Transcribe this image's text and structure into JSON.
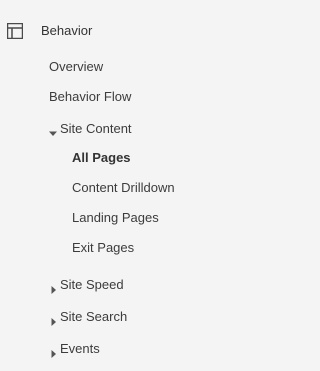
{
  "section": {
    "icon": "layout-icon",
    "label": "Behavior"
  },
  "items": {
    "overview": "Overview",
    "behavior_flow": "Behavior Flow",
    "site_content": "Site Content",
    "all_pages": "All Pages",
    "content_drilldown": "Content Drilldown",
    "landing_pages": "Landing Pages",
    "exit_pages": "Exit Pages",
    "site_speed": "Site Speed",
    "site_search": "Site Search",
    "events": "Events"
  },
  "state": {
    "site_content_expanded": true,
    "active_item": "All Pages"
  },
  "colors": {
    "background": "#f4f4f4",
    "text": "#3c3c3c",
    "icon": "#4a4a4a"
  }
}
